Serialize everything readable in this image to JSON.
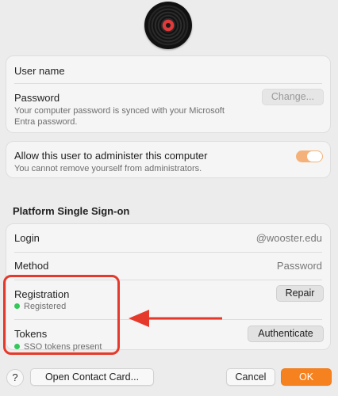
{
  "user": {
    "username_label": "User name",
    "password_label": "Password",
    "password_note": "Your computer password is synced with your Microsoft Entra password.",
    "change_button": "Change..."
  },
  "admin": {
    "label": "Allow this user to administer this computer",
    "note": "You cannot remove yourself from administrators.",
    "enabled": true
  },
  "sso": {
    "section_title": "Platform Single Sign-on",
    "login_label": "Login",
    "login_value": "@wooster.edu",
    "method_label": "Method",
    "method_value": "Password",
    "registration_label": "Registration",
    "registration_status": "Registered",
    "repair_button": "Repair",
    "tokens_label": "Tokens",
    "tokens_status": "SSO tokens present",
    "authenticate_button": "Authenticate"
  },
  "footer": {
    "help_label": "?",
    "contact_button": "Open Contact Card...",
    "cancel_button": "Cancel",
    "ok_button": "OK"
  },
  "colors": {
    "accent": "#f6821f",
    "highlight": "#e5392b",
    "status_green": "#34c759"
  }
}
